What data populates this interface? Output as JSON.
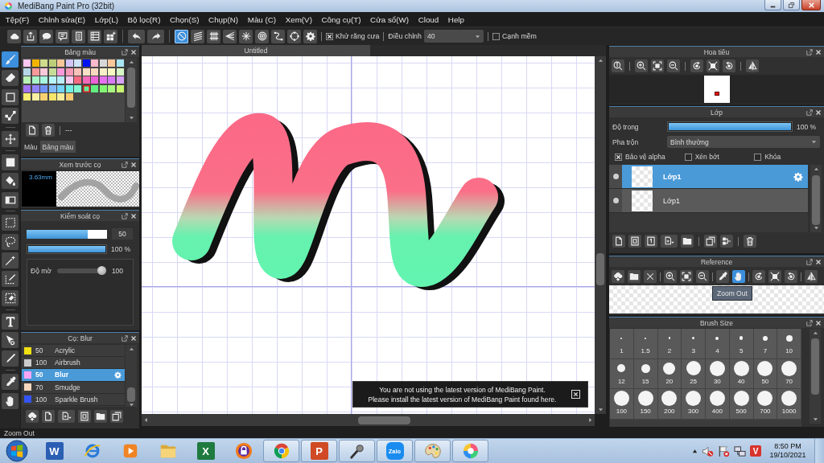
{
  "window": {
    "title": "MediBang Paint Pro (32bit)"
  },
  "menu": [
    "Tệp(F)",
    "Chỉnh sửa(E)",
    "Lớp(L)",
    "Bộ lọc(R)",
    "Chọn(S)",
    "Chụp(N)",
    "Màu (C)",
    "Xem(V)",
    "Công cụ(T)",
    "Cửa sổ(W)",
    "Cloud",
    "Help"
  ],
  "toolbar": {
    "snap_tools": [
      {
        "selected": true
      },
      {
        "selected": false
      },
      {
        "selected": false
      },
      {
        "selected": false
      },
      {
        "selected": false
      },
      {
        "selected": false
      },
      {
        "selected": false
      },
      {
        "selected": false
      }
    ],
    "antialias": {
      "label": "Khử răng cưa",
      "checked": true
    },
    "correction": {
      "label": "Điều chỉnh",
      "value": "40"
    },
    "soft_edge": {
      "label": "Cạnh mềm",
      "checked": false
    }
  },
  "tools": [
    {
      "selected": true
    },
    {
      "selected": false
    },
    {
      "selected": false
    },
    {
      "selected": false
    },
    {
      "selected": false
    },
    {
      "selected": false
    },
    {
      "selected": false
    },
    {
      "selected": false
    },
    {
      "selected": false
    },
    {
      "selected": false
    },
    {
      "selected": false
    },
    {
      "selected": false
    },
    {
      "selected": false
    },
    {
      "selected": false
    },
    {
      "selected": false
    },
    {
      "selected": false
    },
    {
      "selected": false
    },
    {
      "selected": false
    }
  ],
  "color_panel": {
    "title": "Bảng màu",
    "swatches": [
      {
        "color": "#fbc6f0",
        "selected": false
      },
      {
        "color": "#f4b400",
        "selected": false
      },
      {
        "color": "#d0dc8c",
        "selected": false
      },
      {
        "color": "#bccf78",
        "selected": false
      },
      {
        "color": "#f8c698",
        "selected": false
      },
      {
        "color": "#d2c4f6",
        "selected": false
      },
      {
        "color": "#cfe2f8",
        "selected": false
      },
      {
        "color": "#0014f0",
        "selected": false
      },
      {
        "color": "#f8b9ca",
        "selected": false
      },
      {
        "color": "#d8d8d8",
        "selected": false
      },
      {
        "color": "#f8c89a",
        "selected": false
      },
      {
        "color": "#a8e6f4",
        "selected": false
      },
      {
        "color": "#b6d6e8",
        "selected": false
      },
      {
        "color": "#f79a9a",
        "selected": false
      },
      {
        "color": "#f8c9d9",
        "selected": false
      },
      {
        "color": "#c6dd98",
        "selected": false
      },
      {
        "color": "#f79ada",
        "selected": false
      },
      {
        "color": "#f79ab8",
        "selected": false
      },
      {
        "color": "#f8c2b8",
        "selected": false
      },
      {
        "color": "#f9dec8",
        "selected": false
      },
      {
        "color": "#f8d8c0",
        "selected": false
      },
      {
        "color": "#f8f0c8",
        "selected": false
      },
      {
        "color": "#f8f8c2",
        "selected": false
      },
      {
        "color": "#d8f8c8",
        "selected": false
      },
      {
        "color": "#b8f0b6",
        "selected": false
      },
      {
        "color": "#a8f6c8",
        "selected": false
      },
      {
        "color": "#a8f6e0",
        "selected": false
      },
      {
        "color": "#b8f6f6",
        "selected": false
      },
      {
        "color": "#b8eef8",
        "selected": false
      },
      {
        "color": "#f8caf0",
        "selected": false
      },
      {
        "color": "#f86a82",
        "selected": false
      },
      {
        "color": "#f46ab8",
        "selected": false
      },
      {
        "color": "#ee62d8",
        "selected": false
      },
      {
        "color": "#e672f0",
        "selected": false
      },
      {
        "color": "#d67af8",
        "selected": false
      },
      {
        "color": "#d8a2f8",
        "selected": false
      },
      {
        "color": "#a272f0",
        "selected": false
      },
      {
        "color": "#9282f8",
        "selected": false
      },
      {
        "color": "#7092f6",
        "selected": false
      },
      {
        "color": "#82baf8",
        "selected": false
      },
      {
        "color": "#72d2f8",
        "selected": false
      },
      {
        "color": "#72f0e6",
        "selected": false
      },
      {
        "color": "#82f6d0",
        "selected": false
      },
      {
        "color": "#62ee9e",
        "selected": true
      },
      {
        "color": "#62ee80",
        "selected": false
      },
      {
        "color": "#82f672",
        "selected": false
      },
      {
        "color": "#aaf682",
        "selected": false
      },
      {
        "color": "#c8f672",
        "selected": false
      },
      {
        "color": "#f8ee72",
        "selected": false
      },
      {
        "color": "#f8f0a2",
        "selected": false
      },
      {
        "color": "#f8d272",
        "selected": false
      },
      {
        "color": "#f6e66a",
        "selected": false
      },
      {
        "color": "#f8ee9a",
        "selected": false
      },
      {
        "color": "#f8ca72",
        "selected": false
      }
    ],
    "palette_name": "---",
    "tabs": [
      {
        "label": "Màu",
        "selected": false
      },
      {
        "label": "Bảng màu",
        "selected": true
      }
    ]
  },
  "brush_preview": {
    "title": "Xem trước cọ",
    "size": "3.63mm"
  },
  "brush_control": {
    "title": "Kiểm soát cọ",
    "size": {
      "level": 0.76,
      "value": "50"
    },
    "opacity": {
      "level": 1,
      "reading": "100 %"
    },
    "blur": {
      "label": "Độ mờ",
      "level": 1,
      "value": "100"
    }
  },
  "brush_list": {
    "title": "Cọ: Blur",
    "items": [
      {
        "color": "#f0e010",
        "size": "50",
        "name": "Acrylic",
        "selected": false
      },
      {
        "color": "#cccccc",
        "size": "100",
        "name": "Airbrush",
        "selected": false
      },
      {
        "color": "#f8a6f4",
        "size": "50",
        "name": "Blur",
        "selected": true
      },
      {
        "color": "#f8d8bc",
        "size": "70",
        "name": "Smudge",
        "selected": false
      },
      {
        "color": "#3454f4",
        "size": "100",
        "name": "Sparkle Brush",
        "selected": false
      }
    ]
  },
  "canvas": {
    "tabs": [
      {
        "label": "Untitled",
        "selected": true
      }
    ],
    "notice": {
      "lines": [
        "You are not using the latest version of MediBang Paint.",
        "Please install the latest version of MediBang Paint found here."
      ]
    }
  },
  "navigator": {
    "title": "Hoa tiêu"
  },
  "layers": {
    "title": "Lớp",
    "opacity": {
      "label": "Độ trong",
      "level": 1,
      "reading": "100 %"
    },
    "blend": {
      "label": "Pha trộn",
      "value": "Bình thường"
    },
    "options": [
      {
        "label": "Bảo vệ alpha",
        "checked": true
      },
      {
        "label": "Xén bớt",
        "checked": false
      },
      {
        "label": "Khóa",
        "checked": false
      }
    ],
    "items": [
      {
        "name": "Lớp1",
        "selected": true,
        "visible": true
      },
      {
        "name": "Lớp1",
        "selected": false,
        "visible": true
      }
    ]
  },
  "reference": {
    "title": "Reference",
    "tools": [
      {
        "selected": false
      },
      {
        "selected": false
      },
      {
        "selected": false
      },
      {
        "selected": false
      },
      {
        "selected": false
      },
      {
        "selected": false
      },
      {
        "selected": false
      },
      {
        "selected": true
      },
      {
        "selected": false
      },
      {
        "selected": false
      },
      {
        "selected": false
      },
      {
        "selected": false
      }
    ],
    "tooltip": "Zoom Out"
  },
  "brush_size": {
    "title": "Brush Size",
    "sizes": [
      "1",
      "1.5",
      "2",
      "3",
      "4",
      "5",
      "7",
      "10",
      "12",
      "15",
      "20",
      "25",
      "30",
      "40",
      "50",
      "70",
      "100",
      "150",
      "200",
      "300",
      "400",
      "500",
      "700",
      "1000"
    ]
  },
  "status_bar": {
    "text": "Zoom Out"
  },
  "taskbar": {
    "apps": [
      {
        "running": false,
        "glyph": "W"
      },
      {
        "running": false
      },
      {
        "running": false
      },
      {
        "running": false
      },
      {
        "running": false,
        "glyph": "X"
      },
      {
        "running": false
      },
      {
        "running": true
      },
      {
        "running": true,
        "glyph": "P"
      },
      {
        "running": true
      },
      {
        "running": true,
        "glyph": "Zalo"
      },
      {
        "running": true
      },
      {
        "running": true
      }
    ],
    "ime_glyph": "V",
    "time": "8:50 PM",
    "date": "19/10/2021"
  }
}
